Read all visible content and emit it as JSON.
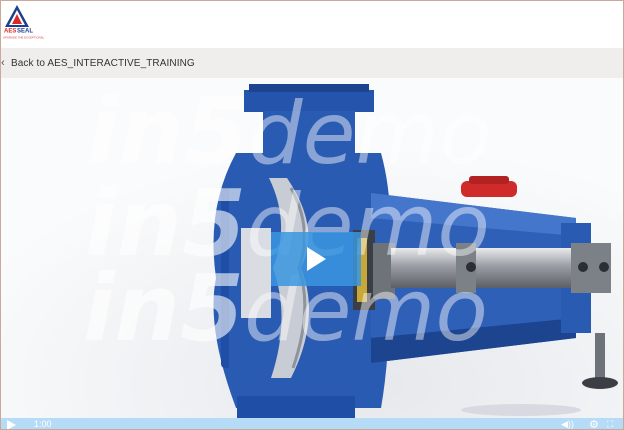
{
  "brand": {
    "logo_text": "AESSEAL",
    "tagline": "UPGRADE THE EXCEPTIONAL",
    "colors": {
      "blue": "#1d3f8f",
      "red": "#d42a2a"
    }
  },
  "nav": {
    "back_icon": "chevron-left-icon",
    "back_label": "Back to AES_INTERACTIVE_TRAINING"
  },
  "video": {
    "watermark_lines": [
      {
        "strong": "in5",
        "light": "demo"
      },
      {
        "strong": "in5",
        "light": "demo"
      },
      {
        "strong": "in5",
        "light": "demo"
      }
    ],
    "play_icon": "play-icon",
    "accent": "#3a96e1",
    "pump_color": "#2a5bb3"
  },
  "controls": {
    "play_icon": "play-icon",
    "time": "1:00",
    "volume_icon": "volume-icon",
    "settings_icon": "gear-icon",
    "fullscreen_icon": "fullscreen-icon"
  }
}
